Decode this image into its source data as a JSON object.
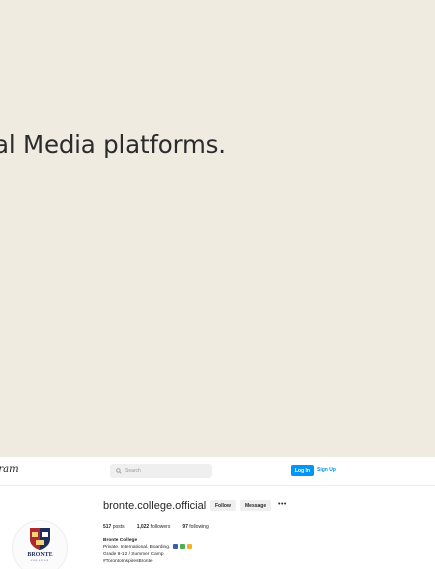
{
  "slide": {
    "text": "al Media platforms."
  },
  "instagram": {
    "logo": "agram",
    "search_placeholder": "Search",
    "login_label": "Log In",
    "signup_label": "Sign Up",
    "profile": {
      "username": "bronte.college.official",
      "follow_label": "Follow",
      "message_label": "Message",
      "more_label": "•••",
      "posts_count": "517",
      "posts_label": "posts",
      "followers_count": "1,022",
      "followers_label": "followers",
      "following_count": "97",
      "following_label": "following",
      "bio_name": "Bronte College",
      "bio_line1": "Private. International. Boarding.",
      "bio_line2": "Grade 9-12 / Summer Camp",
      "bio_line3": "#TorontoInspiresBronte",
      "crest_name": "BRONTE",
      "crest_sub": "COLLEGE"
    }
  },
  "colors": {
    "background": "#efebe1",
    "link_blue": "#0095f6",
    "crest_navy": "#1f2d5c",
    "crest_red": "#b0272d"
  }
}
